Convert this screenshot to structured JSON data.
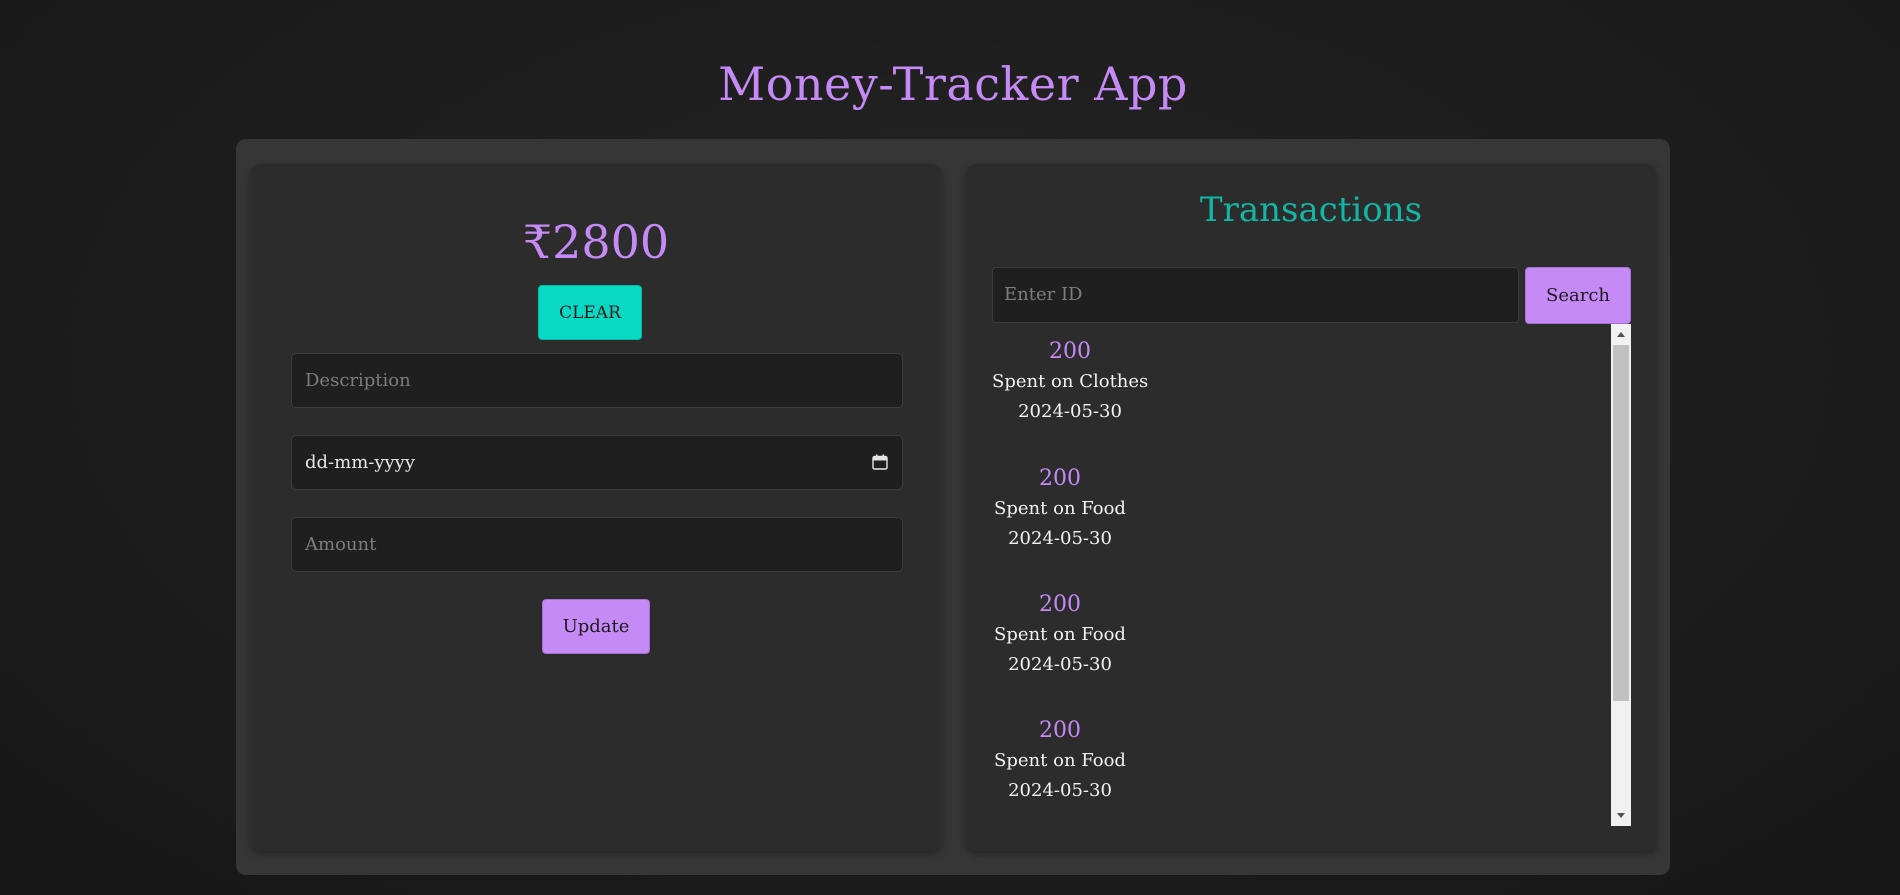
{
  "app": {
    "title": "Money-Tracker App"
  },
  "balance_panel": {
    "balance": "₹2800",
    "clear_label": "CLEAR",
    "description_placeholder": "Description",
    "date_placeholder": "dd-mm-yyyy",
    "amount_placeholder": "Amount",
    "update_label": "Update",
    "date_icon": "calendar-icon"
  },
  "transactions_panel": {
    "title": "Transactions",
    "search_placeholder": "Enter ID",
    "search_label": "Search",
    "items": [
      {
        "amount": "200",
        "description": "Spent on Clothes",
        "date": "2024-05-30"
      },
      {
        "amount": "200",
        "description": "Spent on Food",
        "date": "2024-05-30"
      },
      {
        "amount": "200",
        "description": "Spent on Food",
        "date": "2024-05-30"
      },
      {
        "amount": "200",
        "description": "Spent on Food",
        "date": "2024-05-30"
      }
    ]
  },
  "colors": {
    "accent_purple": "#c58af5",
    "accent_teal": "#08d9c4",
    "title_teal": "#13b5a4",
    "panel_bg": "#2c2c2c",
    "container_bg": "#363636",
    "page_bg": "#1e1e1e"
  }
}
